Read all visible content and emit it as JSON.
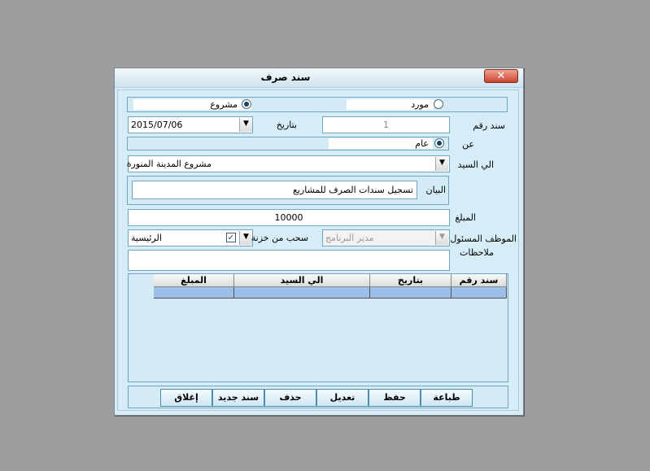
{
  "window": {
    "title": "سند صرف",
    "close_glyph": "✕"
  },
  "type": {
    "option1": "مورد",
    "option2": "مشروع",
    "selected": "مشروع"
  },
  "voucher": {
    "number_label": "سند رقم",
    "number_value": "1",
    "date_label": "بتاريخ",
    "date_value": "2015/07/06"
  },
  "about": {
    "label": "عن",
    "option": "عام"
  },
  "to": {
    "label": "الي السيد",
    "value": "مشروع المدينة المنورة"
  },
  "description": {
    "label": "البيان",
    "value": "تسجيل سندات الصرف للمشاريع"
  },
  "amount": {
    "label": "المبلغ",
    "value": "10000"
  },
  "employee": {
    "label": "الموظف المسئول",
    "value": "مدير البرنامج"
  },
  "safe": {
    "label": "سحب من خزنة",
    "checked": true,
    "value": "الرئيسية"
  },
  "notes": {
    "label": "ملاحظات",
    "value": ""
  },
  "table": {
    "headers": [
      "سند رقم",
      "بتاريخ",
      "الي السيد",
      "المبلغ"
    ]
  },
  "buttons": {
    "print": "طباعة",
    "save": "حفظ",
    "edit": "تعديل",
    "delete": "حذف",
    "new": "سند جديد",
    "close": "إغلاق"
  },
  "icons": {
    "dropdown": "chevron-down-icon",
    "checkbox": "checkmark-icon"
  },
  "colors": {
    "window_bg": "#d9ebf4",
    "border": "#6fa6c4",
    "grid_row": "#9bbfe6",
    "close_btn": "#c8442e"
  }
}
